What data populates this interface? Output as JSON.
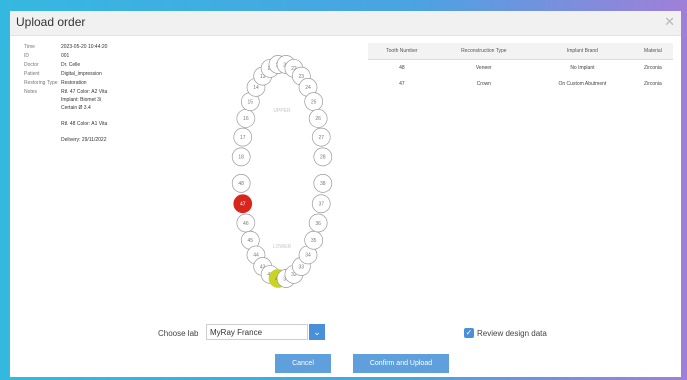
{
  "window": {
    "title": "Upload order"
  },
  "info": {
    "rows": [
      {
        "label": "Time",
        "value": "2023-05-20 10:44:20"
      },
      {
        "label": "ID",
        "value": "001"
      },
      {
        "label": "Doctor",
        "value": "Dr. Celle"
      },
      {
        "label": "Patient",
        "value": "Digital_impression"
      },
      {
        "label": "Restoring Type",
        "value": "Restoration"
      }
    ],
    "notes_label": "Notes",
    "notes": [
      "Rtl. 47 Color: A2 Vita",
      "Implant: Biomet 3i",
      "Certain Ø 3.4",
      "Rtl. 48 Color: A1 Vita",
      "Delivery: 29/11/2022"
    ]
  },
  "teeth": {
    "upper_label": "UPPER",
    "lower_label": "LOWER",
    "upper": [
      "18",
      "17",
      "16",
      "15",
      "14",
      "13",
      "12",
      "11",
      "21",
      "22",
      "23",
      "24",
      "25",
      "26",
      "27",
      "28"
    ],
    "lower": [
      "48",
      "47",
      "46",
      "45",
      "44",
      "43",
      "42",
      "41",
      "31",
      "32",
      "33",
      "34",
      "35",
      "36",
      "37",
      "38"
    ],
    "selected": "47",
    "highlighted": "41",
    "selected_color": "#d9261c",
    "highlight_color": "#c9d426"
  },
  "orders": {
    "columns": [
      "Tooth Number",
      "Reconstruction Type",
      "Implant Brand",
      "Material"
    ],
    "rows": [
      [
        "48",
        "Veneer",
        "No Implant",
        "Zirconia"
      ],
      [
        "47",
        "Crown",
        "On Custom Abutment",
        "Zirconia"
      ]
    ]
  },
  "lab": {
    "label": "Choose lab",
    "value": "MyRay France"
  },
  "review": {
    "label": "Review design data",
    "checked": true
  },
  "buttons": {
    "cancel": "Cancel",
    "confirm": "Confirm and Upload"
  }
}
